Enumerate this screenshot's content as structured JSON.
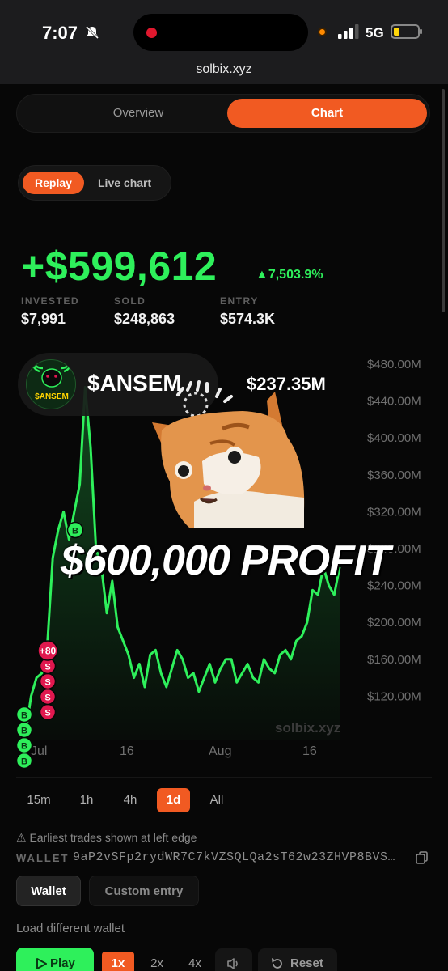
{
  "status_bar": {
    "time": "7:07",
    "network": "5G"
  },
  "browser": {
    "url": "solbix.xyz"
  },
  "view_tabs": {
    "overview": "Overview",
    "chart": "Chart",
    "active": "Chart"
  },
  "mode_tabs": {
    "replay": "Replay",
    "live": "Live chart",
    "active": "Replay"
  },
  "summary": {
    "profit": "+$599,612",
    "percent": "▲7,503.9%",
    "invested_label": "INVESTED",
    "invested_value": "$7,991",
    "sold_label": "SOLD",
    "sold_value": "$248,863",
    "entry_label": "ENTRY",
    "entry_value": "$574.3K"
  },
  "token": {
    "name": "$ANSEM",
    "logo_text": "$ANSEM",
    "market_cap": "$237.35M"
  },
  "overlay": {
    "caption": "$600,000 PROFIT"
  },
  "chart_watermark": "solbix.xyz",
  "chart_data": {
    "type": "line",
    "y_tick_labels": [
      "$480.00M",
      "$440.00M",
      "$400.00M",
      "$360.00M",
      "$320.00M",
      "$280.00M",
      "$240.00M",
      "$200.00M",
      "$160.00M",
      "$120.00M"
    ],
    "x_tick_labels": [
      "Jul",
      "16",
      "Aug",
      "16"
    ],
    "ylim": [
      100,
      490
    ],
    "y_unit": "$M",
    "color": "#2ef05b",
    "values": [
      22,
      80,
      120,
      140,
      145,
      175,
      270,
      300,
      320,
      290,
      320,
      350,
      455,
      390,
      280,
      260,
      210,
      245,
      195,
      180,
      165,
      140,
      155,
      130,
      165,
      170,
      145,
      130,
      150,
      170,
      160,
      140,
      145,
      125,
      140,
      155,
      135,
      150,
      160,
      160,
      135,
      145,
      155,
      140,
      135,
      160,
      150,
      145,
      165,
      170,
      160,
      180,
      185,
      200,
      235,
      230,
      260,
      240,
      230,
      260
    ],
    "markers": [
      {
        "label": "B",
        "type": "buy",
        "index": 0
      },
      {
        "label": "B",
        "type": "buy",
        "index": 0
      },
      {
        "label": "B",
        "type": "buy",
        "index": 0
      },
      {
        "label": "B",
        "type": "buy",
        "index": 0
      },
      {
        "label": "S",
        "type": "sell",
        "index": 6
      },
      {
        "label": "S",
        "type": "sell",
        "index": 6
      },
      {
        "label": "S",
        "type": "sell",
        "index": 6
      },
      {
        "label": "S",
        "type": "sell",
        "index": 6
      },
      {
        "label": "+80",
        "type": "sell",
        "index": 6
      },
      {
        "label": "B",
        "type": "buy",
        "index": 11
      }
    ]
  },
  "timeframes": {
    "items": [
      "15m",
      "1h",
      "4h",
      "1d",
      "All"
    ],
    "active": "1d"
  },
  "info": {
    "note": "⚠ Earliest trades shown at left edge",
    "wallet_label": "WALLET",
    "wallet_address": "9aP2vSFp2rydWR7C7kVZSQLQa2sT62w23ZHVP8BVS…"
  },
  "wallet_tabs": {
    "wallet": "Wallet",
    "custom": "Custom entry"
  },
  "load_wallet": "Load different wallet",
  "controls": {
    "play": "Play",
    "speeds": [
      "1x",
      "2x",
      "4x"
    ],
    "active_speed": "1x",
    "reset": "Reset"
  },
  "colors": {
    "accent": "#f15a22",
    "profit": "#2ef05b",
    "sell": "#e0184e"
  }
}
